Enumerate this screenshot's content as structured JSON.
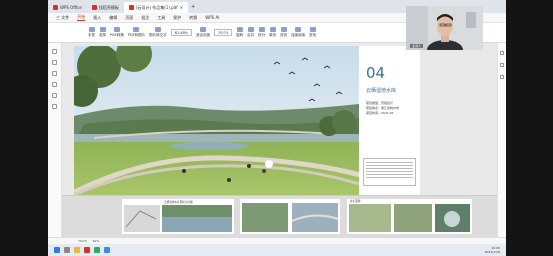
{
  "titlebar": {
    "tabs": [
      {
        "label": "WPS Office",
        "color": "#d6312d"
      },
      {
        "label": "找稻壳模板",
        "color": "#d6312d"
      },
      {
        "label": "(云设计) 作品集(1).pdf",
        "color": "#d6312d"
      }
    ]
  },
  "menubar": {
    "items": [
      "三 文件",
      "开始",
      "插入",
      "编辑",
      "页面",
      "批注",
      "工具",
      "保护",
      "转换",
      "WPS AI"
    ],
    "active_index": 1
  },
  "toolbar": {
    "tools": [
      "手型",
      "选择",
      "PDF转换",
      "PDF转图片",
      "图片转文字",
      "缩放",
      "适合页面",
      "翻页",
      "旋转",
      "合并",
      "拆分",
      "单页",
      "双页",
      "连续阅读",
      "查找",
      "截图"
    ],
    "zoom": "62.48%",
    "page_indicator": "70/74"
  },
  "page": {
    "number": "04",
    "project_name": "云栖湿地水库",
    "meta": [
      "项目类型：景观设计",
      "项目地点：浙江省杭州市",
      "项目时间：2021.05"
    ]
  },
  "thumbs": {
    "caption_1": "云栖湿地水库现状分析图",
    "caption_2": "总平面图"
  },
  "statusbar": {
    "page": "70/74",
    "zoom": "62%"
  },
  "taskbar": {
    "time": "22:05",
    "date": "2023/11/8"
  },
  "webcam": {
    "name": "主讲人"
  }
}
